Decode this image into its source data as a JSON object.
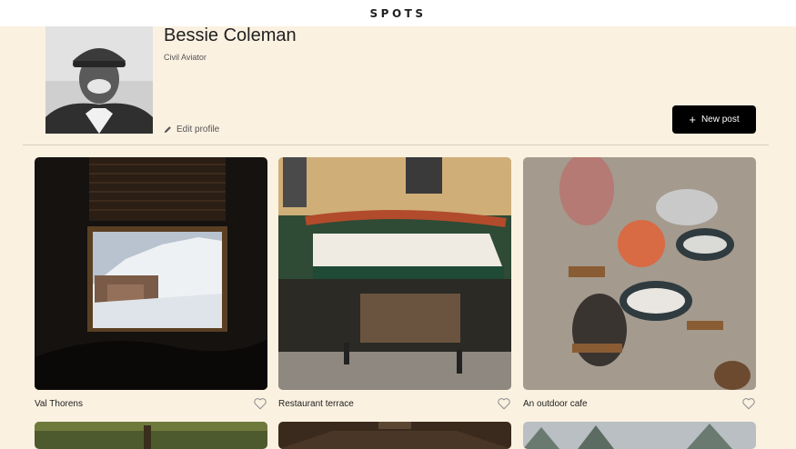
{
  "header": {
    "logo": "SPOTS"
  },
  "profile": {
    "name": "Bessie Coleman",
    "description": "Civil Aviator",
    "edit_label": "Edit profile"
  },
  "actions": {
    "new_post_label": "New post"
  },
  "cards": [
    {
      "title": "Val Thorens",
      "liked": false
    },
    {
      "title": "Restaurant terrace",
      "liked": false
    },
    {
      "title": "An outdoor cafe",
      "liked": false
    }
  ],
  "icons": {
    "edit": "pencil-icon",
    "new_post": "plus-icon",
    "like": "heart-outline-icon"
  },
  "colors": {
    "page_background": "#fbf1e1",
    "header_background": "#ffffff",
    "button_background": "#000000",
    "text": "#212121"
  }
}
